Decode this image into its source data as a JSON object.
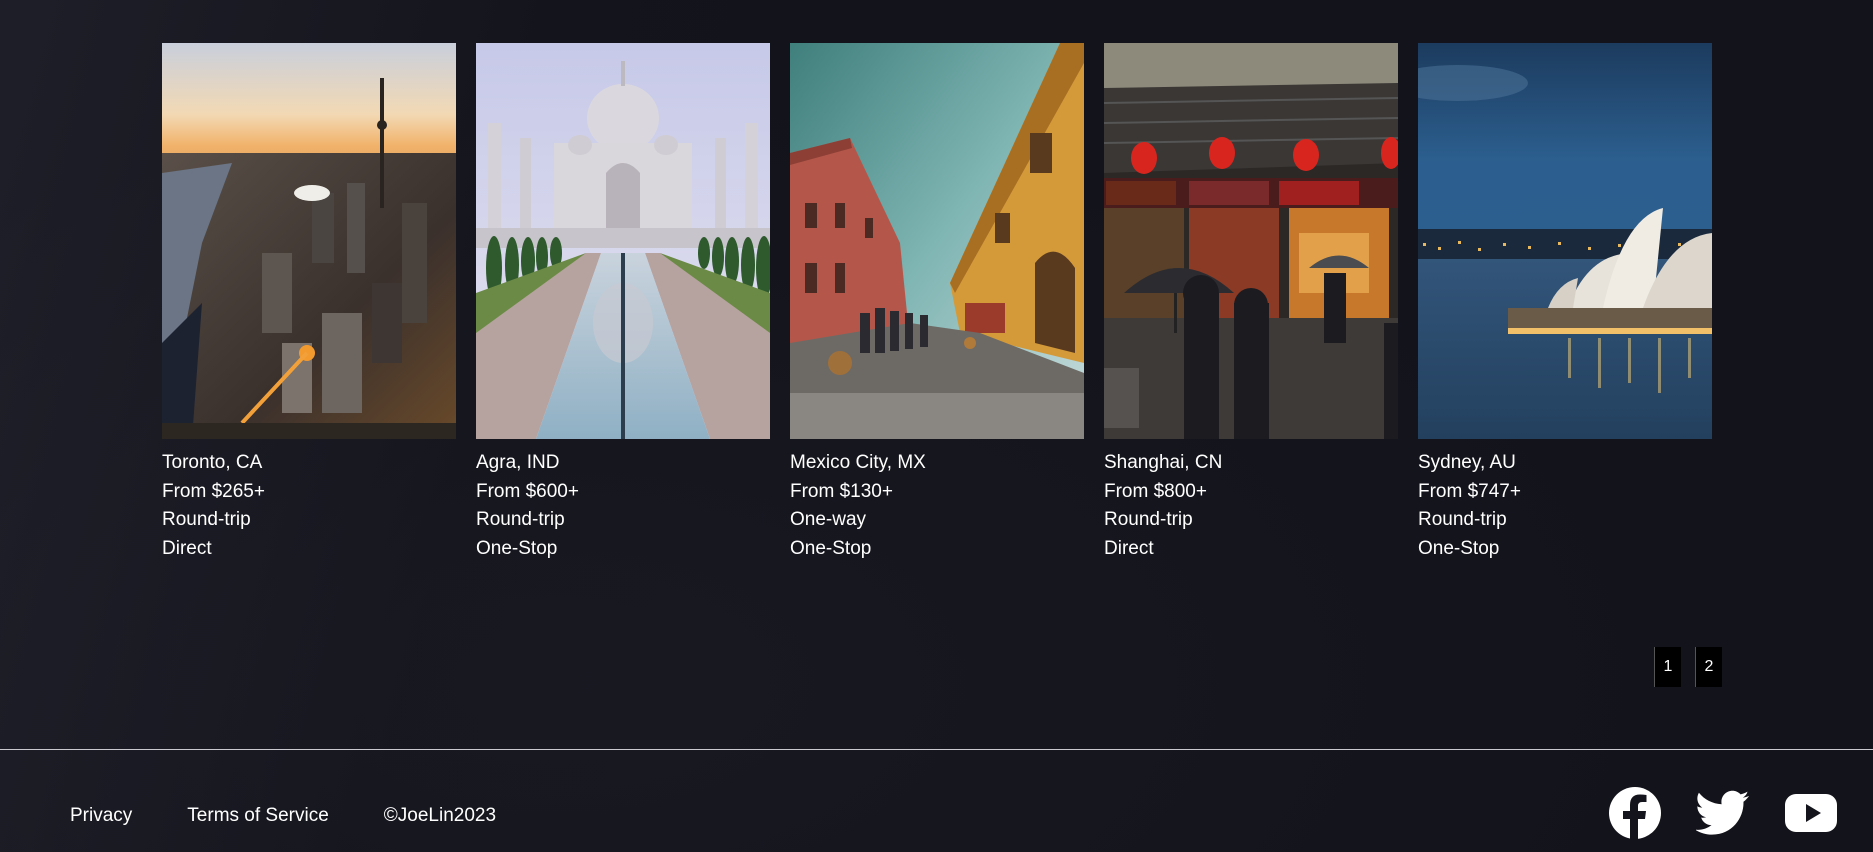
{
  "destinations": [
    {
      "city": "Toronto, CA",
      "price": "From $265+",
      "trip": "Round-trip",
      "stops": "Direct",
      "image": "toronto-skyline-photo"
    },
    {
      "city": "Agra, IND",
      "price": "From $600+",
      "trip": "Round-trip",
      "stops": "One-Stop",
      "image": "taj-mahal-photo"
    },
    {
      "city": "Mexico City, MX",
      "price": "From $130+",
      "trip": "One-way",
      "stops": "One-Stop",
      "image": "mexico-street-photo"
    },
    {
      "city": "Shanghai, CN",
      "price": "From $800+",
      "trip": "Round-trip",
      "stops": "Direct",
      "image": "shanghai-street-photo"
    },
    {
      "city": "Sydney, AU",
      "price": "From $747+",
      "trip": "Round-trip",
      "stops": "One-Stop",
      "image": "sydney-opera-house-photo"
    }
  ],
  "pagination": {
    "page1": "1",
    "page2": "2"
  },
  "footer": {
    "privacy": "Privacy",
    "terms": "Terms of Service",
    "copyright": "©JoeLin2023",
    "social_icons": [
      "facebook-icon",
      "twitter-icon",
      "youtube-icon"
    ]
  }
}
